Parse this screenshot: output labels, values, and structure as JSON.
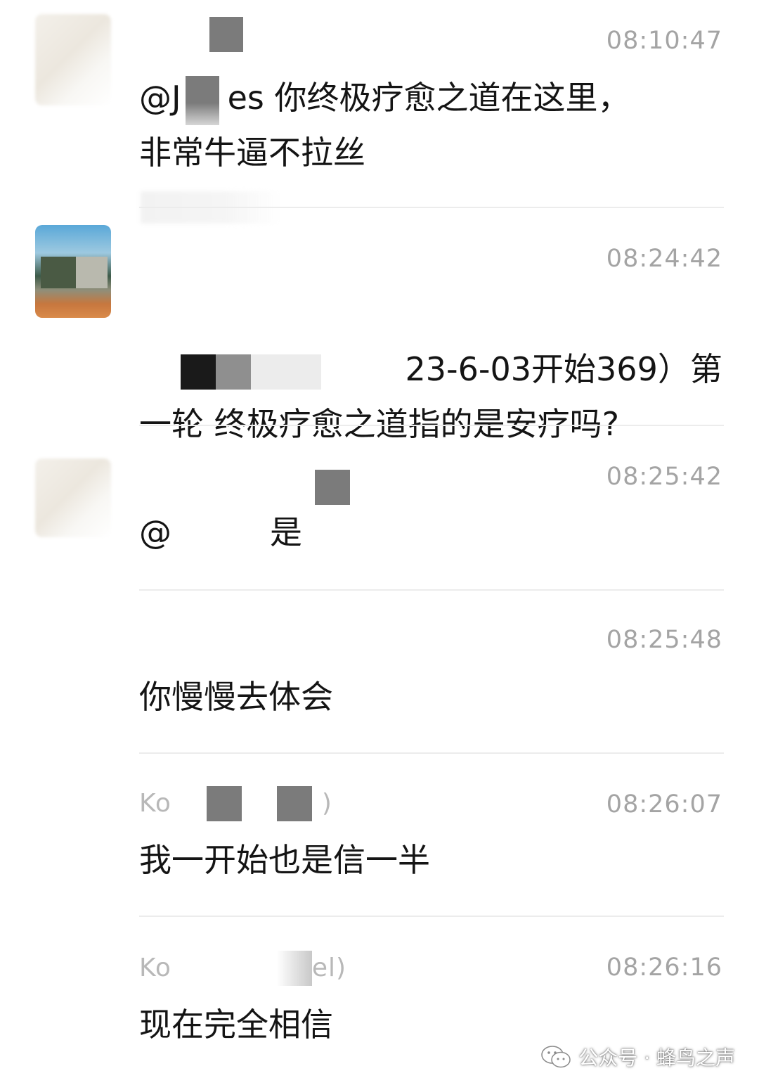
{
  "messages": [
    {
      "sender": "",
      "time": "08:10:47",
      "text_parts": [
        "@J",
        "es 你终极疗愈之道在这里，",
        "非常牛逼不拉丝"
      ]
    },
    {
      "sender": "",
      "time": "08:24:42",
      "text_parts": [
        "23-6-03开始369）第",
        "一轮 终极疗愈之道指的是安疗吗?"
      ]
    },
    {
      "sender": "",
      "time": "08:25:42",
      "text_parts": [
        "@",
        "是"
      ]
    },
    {
      "sender": "",
      "time": "08:25:48",
      "text_parts": [
        "你慢慢去体会"
      ]
    },
    {
      "sender": "Ko",
      "sender_suffix": ")",
      "time": "08:26:07",
      "text_parts": [
        "我一开始也是信一半"
      ]
    },
    {
      "sender": "Ko",
      "sender_suffix": "el)",
      "time": "08:26:16",
      "text_parts": [
        "现在完全相信"
      ]
    }
  ],
  "watermark": {
    "text": "公众号 · 蜂鸟之声",
    "icon": "wechat-icon"
  },
  "colors": {
    "text": "#141414",
    "timestamp": "#a4a4a4",
    "divider": "#ececec",
    "mosaic_dark": "#7b7b7b"
  }
}
